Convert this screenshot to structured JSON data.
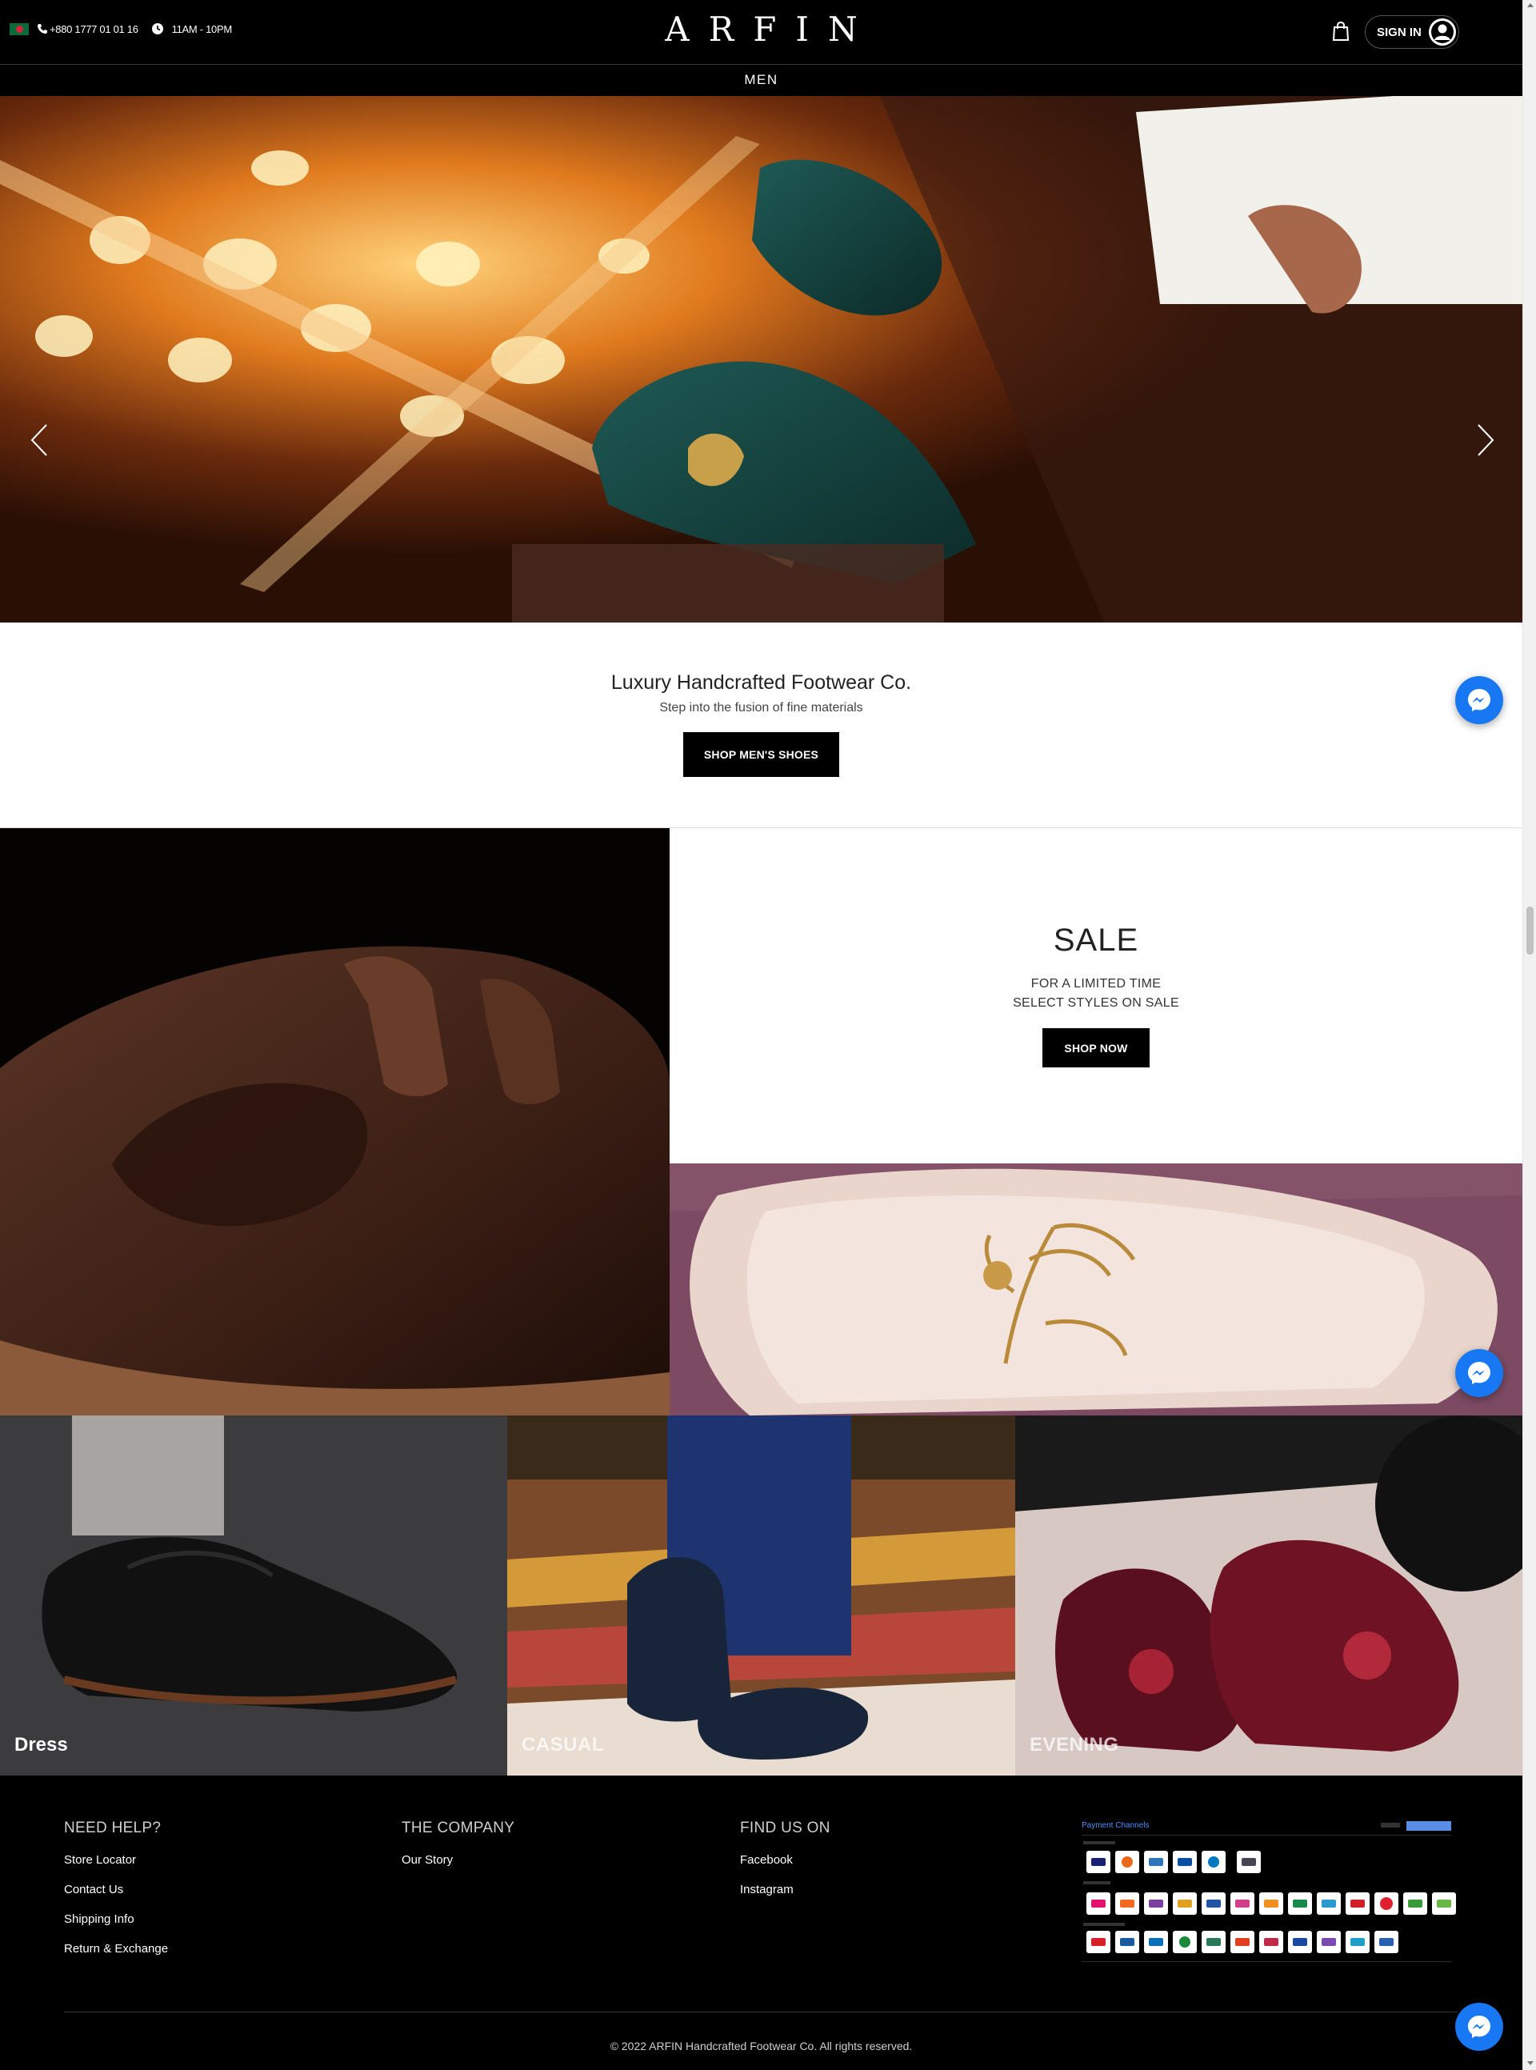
{
  "header": {
    "phone": "+880 1777 01 01 16",
    "hours": "11AM - 10PM",
    "logo": "ARFIN",
    "signin_label": "SIGN IN",
    "icons": [
      "flag-icon",
      "phone-icon",
      "clock-icon",
      "cart-icon",
      "user-icon"
    ]
  },
  "nav": {
    "men": "MEN"
  },
  "hero": {
    "prev_icon": "chevron-left-icon",
    "next_icon": "chevron-right-icon"
  },
  "intro": {
    "title": "Luxury Handcrafted Footwear Co.",
    "subtitle": "Step into the fusion of fine materials",
    "button": "SHOP MEN'S SHOES"
  },
  "sale": {
    "title": "SALE",
    "line1": "FOR A LIMITED TIME",
    "line2": "SELECT STYLES ON SALE",
    "button": "SHOP NOW"
  },
  "categories": [
    {
      "label": "Dress"
    },
    {
      "label": "CASUAL"
    },
    {
      "label": "EVENING"
    }
  ],
  "footer": {
    "help": {
      "title": "NEED HELP?",
      "links": [
        "Store Locator",
        "Contact Us",
        "Shipping Info",
        "Return & Exchange"
      ]
    },
    "company": {
      "title": "THE COMPANY",
      "links": [
        "Our Story"
      ]
    },
    "find": {
      "title": "FIND US ON",
      "links": [
        "Facebook",
        "Instagram"
      ]
    },
    "payment": {
      "title": "Payment Channels"
    },
    "copyright": "© 2022 ARFIN Handcrafted Footwear Co. All rights reserved."
  },
  "colors": {
    "header_bg": "#000000",
    "messenger": "#1877f2",
    "button_bg": "#000000",
    "footer_bg": "#000000"
  }
}
